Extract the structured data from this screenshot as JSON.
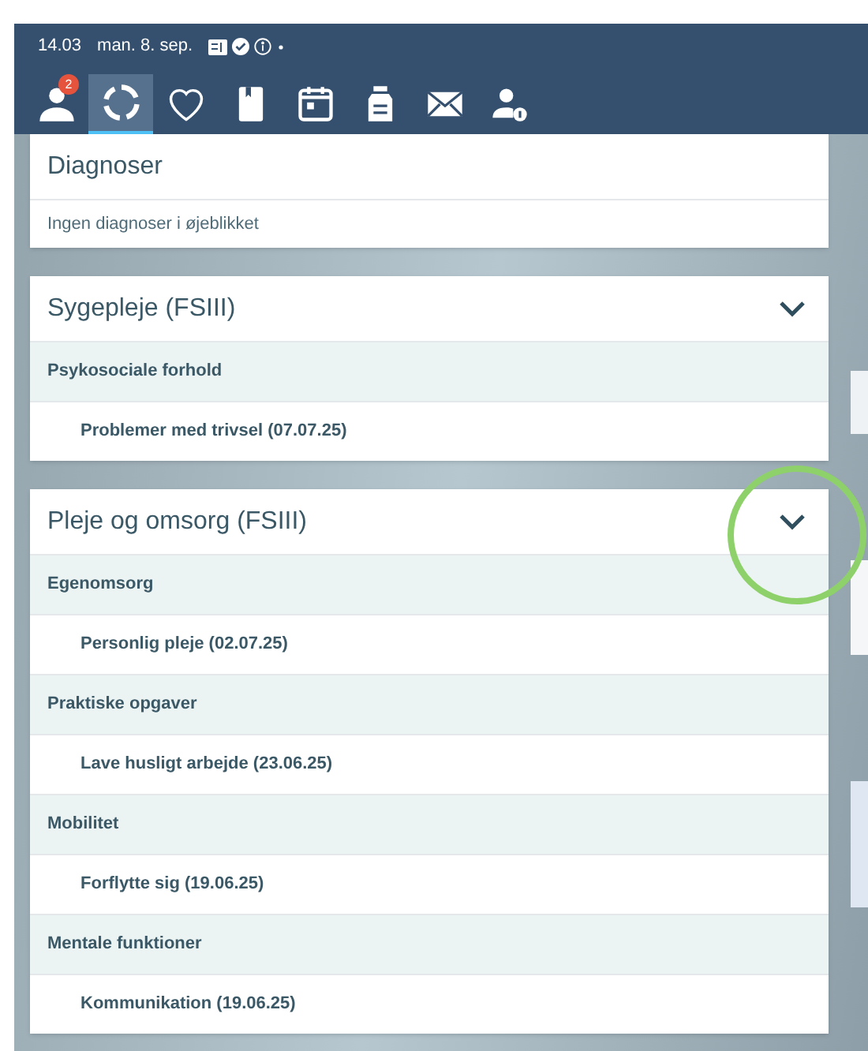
{
  "status_bar": {
    "time": "14.03",
    "date": "man. 8. sep."
  },
  "nav_tabs": [
    {
      "selected": false,
      "badge": "2"
    },
    {
      "selected": true
    },
    {
      "selected": false
    },
    {
      "selected": false
    },
    {
      "selected": false
    },
    {
      "selected": false
    },
    {
      "selected": false
    },
    {
      "selected": false
    }
  ],
  "sections": [
    {
      "title": "Diagnoser",
      "expandable": false,
      "rows": [
        {
          "kind": "note",
          "text": "Ingen diagnoser i øjeblikket"
        }
      ]
    },
    {
      "title": "Sygepleje (FSIII)",
      "expandable": true,
      "rows": [
        {
          "kind": "category",
          "text": "Psykosociale forhold"
        },
        {
          "kind": "item",
          "text": "Problemer med trivsel (07.07.25)"
        }
      ]
    },
    {
      "title": "Pleje og omsorg (FSIII)",
      "expandable": true,
      "highlighted": true,
      "rows": [
        {
          "kind": "category",
          "text": "Egenomsorg"
        },
        {
          "kind": "item",
          "text": "Personlig pleje (02.07.25)"
        },
        {
          "kind": "category",
          "text": "Praktiske opgaver"
        },
        {
          "kind": "item",
          "text": "Lave husligt arbejde (23.06.25)"
        },
        {
          "kind": "category",
          "text": "Mobilitet"
        },
        {
          "kind": "item",
          "text": "Forflytte sig (19.06.25)"
        },
        {
          "kind": "category",
          "text": "Mentale funktioner"
        },
        {
          "kind": "item",
          "text": "Kommunikation (19.06.25)"
        }
      ]
    }
  ]
}
